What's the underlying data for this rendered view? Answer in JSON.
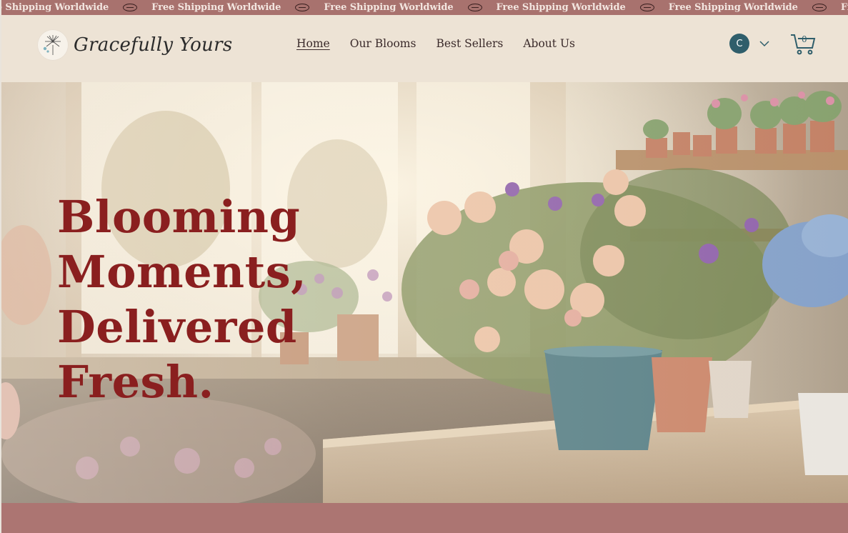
{
  "marquee": {
    "items": [
      "Free Shipping Worldwide",
      "Free Shipping Worldwide",
      "Free Shipping Worldwide",
      "Free Shipping Worldwide",
      "Free Shipping Worldwide",
      "Free Shipping Worldwide"
    ],
    "separator_icon": "oval-separator-icon"
  },
  "header": {
    "brand_name": "Gracefully Yours",
    "logo_icon": "dandelion-icon",
    "nav": [
      {
        "label": "Home",
        "active": true
      },
      {
        "label": "Our Blooms",
        "active": false
      },
      {
        "label": "Best Sellers",
        "active": false
      },
      {
        "label": "About Us",
        "active": false
      }
    ],
    "account": {
      "avatar_initial": "C",
      "menu_icon": "chevron-down-icon"
    },
    "cart": {
      "count": "0",
      "icon": "cart-icon"
    }
  },
  "hero": {
    "title_lines": [
      "Blooming",
      "Moments,",
      "Delivered",
      "Fresh."
    ],
    "image": "flower-shop-bouquet-photo"
  },
  "colors": {
    "marquee_bg": "#a8726e",
    "header_bg": "#ede3d5",
    "title": "#8a1f1f",
    "avatar": "#2f5e6b",
    "footer_band": "#ac7572"
  }
}
